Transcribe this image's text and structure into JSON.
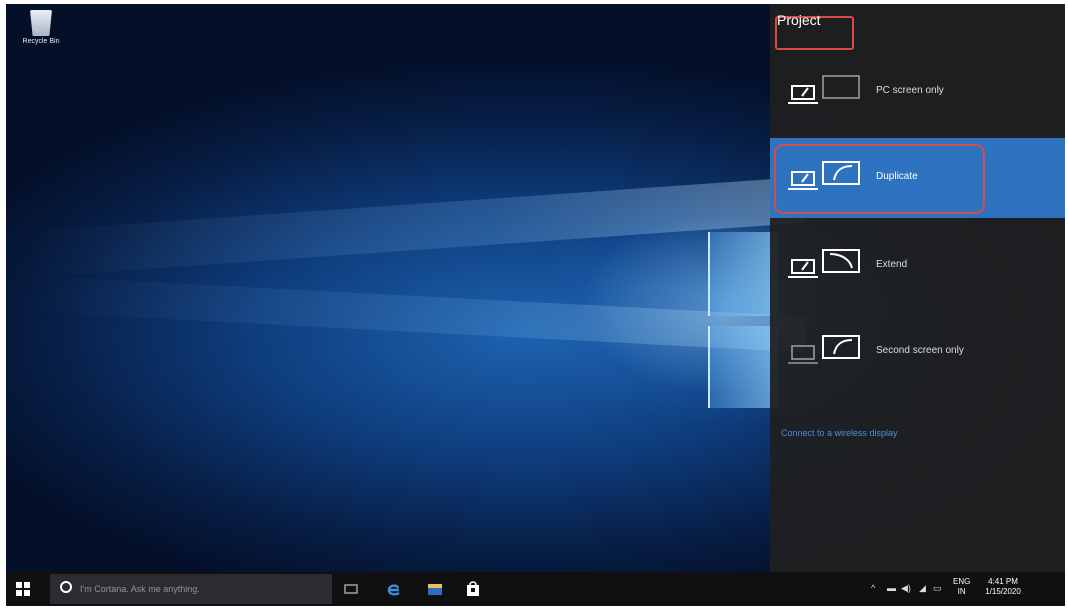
{
  "desktop": {
    "recycle_bin_label": "Recycle Bin"
  },
  "project_panel": {
    "title": "Project",
    "options": [
      {
        "label": "PC screen only",
        "selected": false,
        "icons": [
          "laptop-active-icon",
          "monitor-blank-icon"
        ]
      },
      {
        "label": "Duplicate",
        "selected": true,
        "icons": [
          "laptop-active-icon",
          "monitor-active-icon"
        ]
      },
      {
        "label": "Extend",
        "selected": false,
        "icons": [
          "laptop-active-icon",
          "monitor-extend-icon"
        ]
      },
      {
        "label": "Second screen only",
        "selected": false,
        "icons": [
          "laptop-blank-icon",
          "monitor-active-icon"
        ]
      }
    ],
    "connect_link": "Connect to a wireless display",
    "selected_color": "#2d73bf",
    "highlight_color": "#d94a4a"
  },
  "taskbar": {
    "search_placeholder": "I'm Cortana. Ask me anything.",
    "pinned": [
      "task-view-icon",
      "edge-icon",
      "file-explorer-icon",
      "store-icon"
    ],
    "tray": {
      "language": "ENG",
      "region": "IN",
      "time": "4:41 PM",
      "date": "1/15/2020"
    }
  }
}
